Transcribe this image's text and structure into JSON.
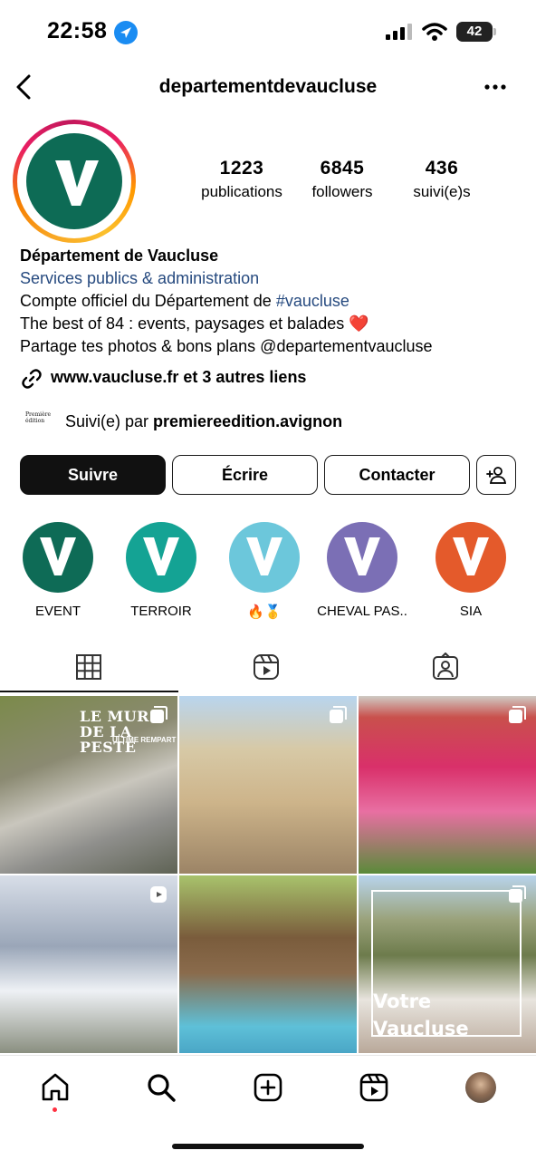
{
  "status_bar": {
    "time": "22:58",
    "battery": "42"
  },
  "header": {
    "username": "departementdevaucluse"
  },
  "stats": [
    {
      "value": "1223",
      "label": "publications"
    },
    {
      "value": "6845",
      "label": "followers"
    },
    {
      "value": "436",
      "label": "suivi(e)s"
    }
  ],
  "bio": {
    "name": "Département de Vaucluse",
    "category": "Services publics & administration",
    "line1_prefix": "Compte officiel du Département de ",
    "line1_hashtag": "#vaucluse",
    "line2": "The best of 84 : events, paysages et balades",
    "line2_emoji": "❤️",
    "line3": "Partage tes photos & bons plans  @departementvaucluse",
    "link": "www.vaucluse.fr et 3 autres liens"
  },
  "followed_by": {
    "prefix": "Suivi(e) par ",
    "name": "premiereedition.avignon",
    "mini_logo": "Première édition"
  },
  "buttons": {
    "follow": "Suivre",
    "message": "Écrire",
    "contact": "Contacter"
  },
  "highlights": [
    {
      "label": "EVENT",
      "color": "#0e6b56"
    },
    {
      "label": "TERROIR",
      "color": "#14a394"
    },
    {
      "label": "🔥🥇",
      "color": "#6cc7db"
    },
    {
      "label": "CHEVAL PAS..",
      "color": "#7b6fb5"
    },
    {
      "label": "SIA",
      "color": "#e45a2b"
    }
  ],
  "posts": [
    {
      "title": "LE MUR DE LA PESTE",
      "subtitle": "ULTIME REMPART"
    },
    {
      "title": ""
    },
    {
      "title": ""
    },
    {
      "title": ""
    },
    {
      "title": ""
    },
    {
      "title": "Votre Vaucluse"
    }
  ],
  "colors": {
    "brand_green": "#0d6b55",
    "link_blue": "#264a7f",
    "notification": "#ff3040"
  },
  "icons": [
    "back-arrow-icon",
    "more-icon",
    "link-icon",
    "add-user-icon",
    "grid-icon",
    "reels-icon",
    "tagged-icon",
    "home-icon",
    "search-icon",
    "create-icon",
    "reels-nav-icon"
  ]
}
